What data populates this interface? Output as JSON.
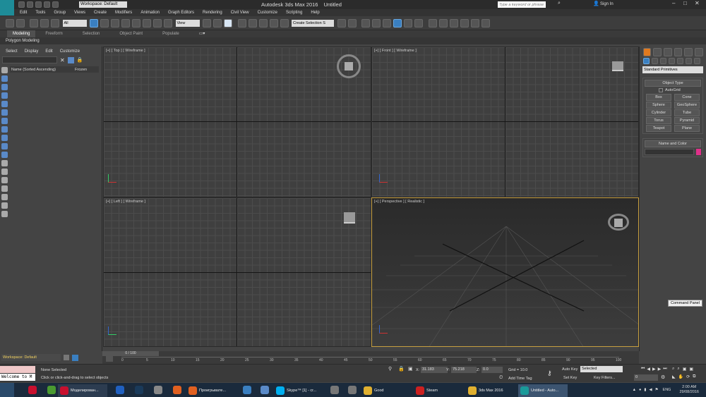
{
  "title": {
    "app": "Autodesk 3ds Max 2016",
    "doc": "Untitled",
    "workspace": "Workspace: Default",
    "search_placeholder": "Type a keyword or phrase",
    "signin": "Sign In"
  },
  "menu": [
    "Edit",
    "Tools",
    "Group",
    "Views",
    "Create",
    "Modifiers",
    "Animation",
    "Graph Editors",
    "Rendering",
    "Civil View",
    "Customize",
    "Scripting",
    "Help"
  ],
  "toolbar": {
    "filter": "All",
    "view": "View",
    "selection_set": "Create Selection S"
  },
  "ribbon": {
    "tabs": [
      "Modeling",
      "Freeform",
      "Selection",
      "Object Paint",
      "Populate"
    ],
    "sub": "Polygon Modeling"
  },
  "scene": {
    "menu": [
      "Select",
      "Display",
      "Edit",
      "Customize"
    ],
    "col_name": "Name (Sorted Ascending)",
    "col_frozen": "Frozen"
  },
  "viewports": [
    {
      "label": "[+] [ Top ] [ Wireframe ]"
    },
    {
      "label": "[+] [ Front ] [ Wireframe ]"
    },
    {
      "label": "[+] [ Left ] [ Wireframe ]"
    },
    {
      "label": "[+] [ Perspective ] [ Realistic ]"
    }
  ],
  "cmd": {
    "dropdown": "Standard Primitives",
    "object_type": "Object Type",
    "autogrid": "AutoGrid",
    "buttons": [
      "Box",
      "Cone",
      "Sphere",
      "GeoSphere",
      "Cylinder",
      "Tube",
      "Torus",
      "Pyramid",
      "Teapot",
      "Plane"
    ],
    "name_color": "Name and Color",
    "tooltip": "Command Panel",
    "swatch": "#e0308a"
  },
  "timeline": {
    "frame": "0 / 100",
    "ticks": [
      "0",
      "5",
      "10",
      "15",
      "20",
      "25",
      "30",
      "35",
      "40",
      "45",
      "50",
      "55",
      "60",
      "65",
      "70",
      "75",
      "80",
      "85",
      "90",
      "95",
      "100"
    ]
  },
  "status": {
    "workspace": "Workspace: Default",
    "selected": "None Selected",
    "hint": "Click or click-and-drag to select objects",
    "maxscript": "Welcome to M",
    "x_label": "X:",
    "x": "31.183",
    "y_label": "Y:",
    "y": "75.218",
    "z_label": "Z:",
    "z": "0.0",
    "grid": "Grid = 10.0",
    "add_time_tag": "Add Time Tag",
    "auto_key": "Auto Key",
    "selected_dd": "Selected",
    "set_key": "Set Key",
    "key_filters": "Key Filters...",
    "frame_field": "0"
  },
  "taskbar": {
    "items": [
      {
        "label": "Моделирован...",
        "color": "#c8102e"
      },
      {
        "label": "Проигрывате...",
        "color": "#e06020"
      },
      {
        "label": "Skype™ [1] - cr...",
        "color": "#00aff0"
      },
      {
        "label": "Good",
        "color": "#e0b030"
      },
      {
        "label": "Steam",
        "color": "#cc2020"
      },
      {
        "label": "3ds Max 2016",
        "color": "#e0b030"
      },
      {
        "label": "Untitled - Auto...",
        "color": "#1a9a9a"
      }
    ],
    "lang": "ENG",
    "time": "2:00 AM",
    "date": "29/08/2016"
  }
}
